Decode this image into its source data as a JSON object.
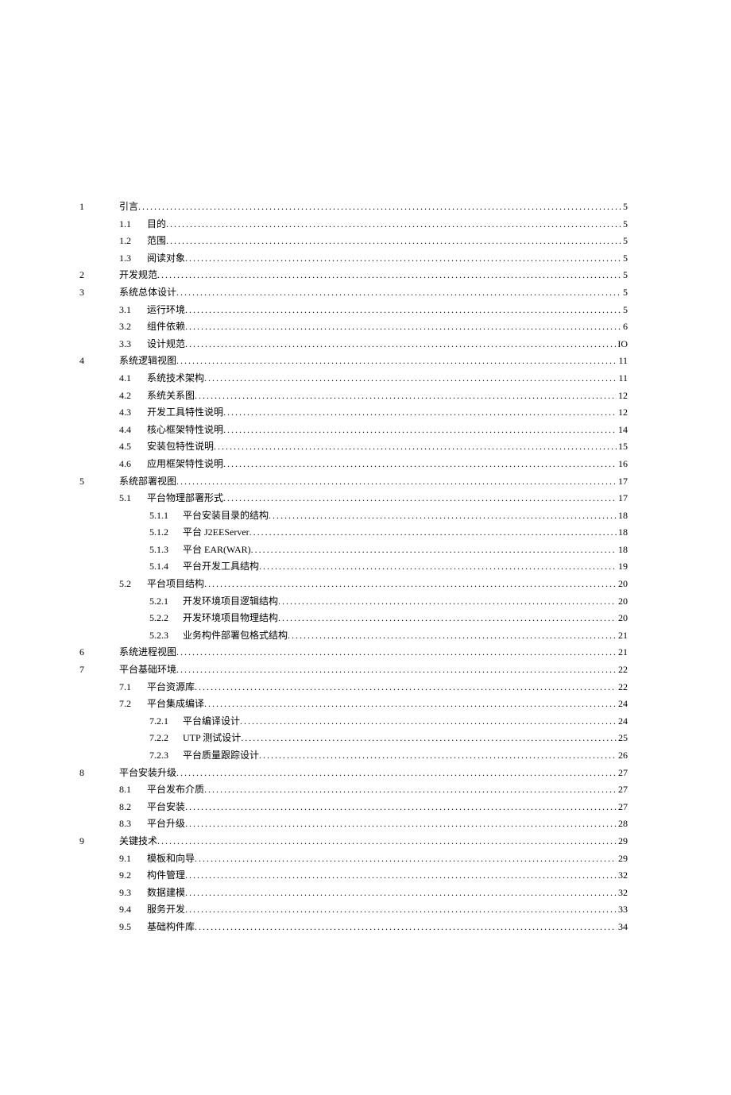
{
  "toc": [
    {
      "level": 1,
      "num": "1",
      "title": "引言",
      "page": "5"
    },
    {
      "level": 2,
      "num": "1.1",
      "title": "目的",
      "page": "5"
    },
    {
      "level": 2,
      "num": "1.2",
      "title": "范围",
      "page": "5"
    },
    {
      "level": 2,
      "num": "1.3",
      "title": "阅读对象",
      "page": "5"
    },
    {
      "level": 1,
      "num": "2",
      "title": "开发规范",
      "page": "5"
    },
    {
      "level": 1,
      "num": "3",
      "title": "系统总体设计",
      "page": "5"
    },
    {
      "level": 2,
      "num": "3.1",
      "title": "运行环境",
      "page": "5"
    },
    {
      "level": 2,
      "num": "3.2",
      "title": "组件依赖",
      "page": "6"
    },
    {
      "level": 2,
      "num": "3.3",
      "title": "设计规范",
      "page": "IO"
    },
    {
      "level": 1,
      "num": "4",
      "title": "系统逻辑视图",
      "page": "11"
    },
    {
      "level": 2,
      "num": "4.1",
      "title": "系统技术架构",
      "page": "11"
    },
    {
      "level": 2,
      "num": "4.2",
      "title": "系统关系图",
      "page": "12"
    },
    {
      "level": 2,
      "num": "4.3",
      "title": "开发工具特性说明",
      "page": "12"
    },
    {
      "level": 2,
      "num": "4.4",
      "title": "核心框架特性说明",
      "page": "14"
    },
    {
      "level": 2,
      "num": "4.5",
      "title": "安装包特性说明",
      "page": "15"
    },
    {
      "level": 2,
      "num": "4.6",
      "title": "应用框架特性说明",
      "page": "16"
    },
    {
      "level": 1,
      "num": "5",
      "title": "系统部署视图",
      "page": "17"
    },
    {
      "level": 2,
      "num": "5.1",
      "title": "平台物理部署形式",
      "page": "17"
    },
    {
      "level": 3,
      "num": "5.1.1",
      "title": "平台安装目录的结构",
      "page": "18"
    },
    {
      "level": 3,
      "num": "5.1.2",
      "title": "平台 J2EEServer",
      "page": "18"
    },
    {
      "level": 3,
      "num": "5.1.3",
      "title": "平台 EAR(WAR)",
      "page": "18"
    },
    {
      "level": 3,
      "num": "5.1.4",
      "title": "平台开发工具结构",
      "page": "19"
    },
    {
      "level": 2,
      "num": "5.2",
      "title": "平台项目结构",
      "page": "20"
    },
    {
      "level": 3,
      "num": "5.2.1",
      "title": "开发环境项目逻辑结构",
      "page": "20"
    },
    {
      "level": 3,
      "num": "5.2.2",
      "title": "开发环境项目物理结构",
      "page": "20"
    },
    {
      "level": 3,
      "num": "5.2.3",
      "title": "业务构件部署包格式结构",
      "page": "21"
    },
    {
      "level": 1,
      "num": "6",
      "title": "系统进程视图",
      "page": "21"
    },
    {
      "level": 1,
      "num": "7",
      "title": "平台基础环境",
      "page": "22"
    },
    {
      "level": 2,
      "num": "7.1",
      "title": "平台资源库",
      "page": "22"
    },
    {
      "level": 2,
      "num": "7.2",
      "title": "平台集成编译",
      "page": "24"
    },
    {
      "level": 3,
      "num": "7.2.1",
      "title": "平台编译设计",
      "page": "24"
    },
    {
      "level": 3,
      "num": "7.2.2",
      "title": "UTP 测试设计",
      "page": "25"
    },
    {
      "level": 3,
      "num": "7.2.3",
      "title": "平台质量跟踪设计",
      "page": "26"
    },
    {
      "level": 1,
      "num": "8",
      "title": "平台安装升级",
      "page": "27"
    },
    {
      "level": 2,
      "num": "8.1",
      "title": "平台发布介质",
      "page": "27"
    },
    {
      "level": 2,
      "num": "8.2",
      "title": "平台安装",
      "page": "27"
    },
    {
      "level": 2,
      "num": "8.3",
      "title": "平台升级",
      "page": "28"
    },
    {
      "level": 1,
      "num": "9",
      "title": "关键技术",
      "page": "29"
    },
    {
      "level": 2,
      "num": "9.1",
      "title": "模板和向导",
      "page": "29"
    },
    {
      "level": 2,
      "num": "9.2",
      "title": "构件管理",
      "page": "32"
    },
    {
      "level": 2,
      "num": "9.3",
      "title": "数据建模",
      "page": "32"
    },
    {
      "level": 2,
      "num": "9.4",
      "title": "服务开发",
      "page": "33"
    },
    {
      "level": 2,
      "num": "9.5",
      "title": "基础构件库",
      "page": "34"
    }
  ]
}
